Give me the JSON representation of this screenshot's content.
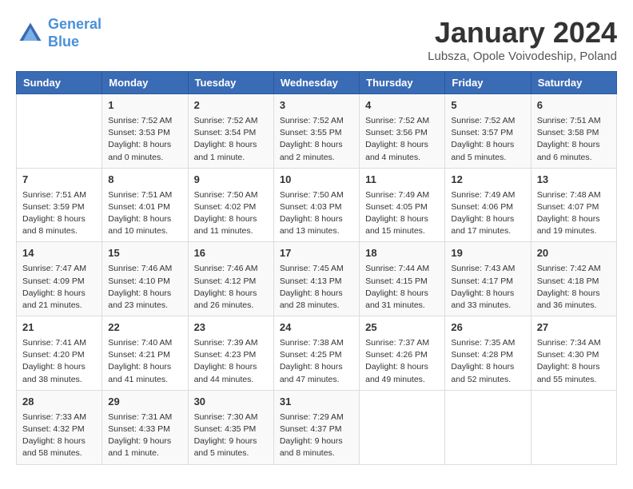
{
  "header": {
    "logo_line1": "General",
    "logo_line2": "Blue",
    "title": "January 2024",
    "subtitle": "Lubsza, Opole Voivodeship, Poland"
  },
  "weekdays": [
    "Sunday",
    "Monday",
    "Tuesday",
    "Wednesday",
    "Thursday",
    "Friday",
    "Saturday"
  ],
  "weeks": [
    [
      {
        "day": "",
        "info": ""
      },
      {
        "day": "1",
        "info": "Sunrise: 7:52 AM\nSunset: 3:53 PM\nDaylight: 8 hours\nand 0 minutes."
      },
      {
        "day": "2",
        "info": "Sunrise: 7:52 AM\nSunset: 3:54 PM\nDaylight: 8 hours\nand 1 minute."
      },
      {
        "day": "3",
        "info": "Sunrise: 7:52 AM\nSunset: 3:55 PM\nDaylight: 8 hours\nand 2 minutes."
      },
      {
        "day": "4",
        "info": "Sunrise: 7:52 AM\nSunset: 3:56 PM\nDaylight: 8 hours\nand 4 minutes."
      },
      {
        "day": "5",
        "info": "Sunrise: 7:52 AM\nSunset: 3:57 PM\nDaylight: 8 hours\nand 5 minutes."
      },
      {
        "day": "6",
        "info": "Sunrise: 7:51 AM\nSunset: 3:58 PM\nDaylight: 8 hours\nand 6 minutes."
      }
    ],
    [
      {
        "day": "7",
        "info": "Sunrise: 7:51 AM\nSunset: 3:59 PM\nDaylight: 8 hours\nand 8 minutes."
      },
      {
        "day": "8",
        "info": "Sunrise: 7:51 AM\nSunset: 4:01 PM\nDaylight: 8 hours\nand 10 minutes."
      },
      {
        "day": "9",
        "info": "Sunrise: 7:50 AM\nSunset: 4:02 PM\nDaylight: 8 hours\nand 11 minutes."
      },
      {
        "day": "10",
        "info": "Sunrise: 7:50 AM\nSunset: 4:03 PM\nDaylight: 8 hours\nand 13 minutes."
      },
      {
        "day": "11",
        "info": "Sunrise: 7:49 AM\nSunset: 4:05 PM\nDaylight: 8 hours\nand 15 minutes."
      },
      {
        "day": "12",
        "info": "Sunrise: 7:49 AM\nSunset: 4:06 PM\nDaylight: 8 hours\nand 17 minutes."
      },
      {
        "day": "13",
        "info": "Sunrise: 7:48 AM\nSunset: 4:07 PM\nDaylight: 8 hours\nand 19 minutes."
      }
    ],
    [
      {
        "day": "14",
        "info": "Sunrise: 7:47 AM\nSunset: 4:09 PM\nDaylight: 8 hours\nand 21 minutes."
      },
      {
        "day": "15",
        "info": "Sunrise: 7:46 AM\nSunset: 4:10 PM\nDaylight: 8 hours\nand 23 minutes."
      },
      {
        "day": "16",
        "info": "Sunrise: 7:46 AM\nSunset: 4:12 PM\nDaylight: 8 hours\nand 26 minutes."
      },
      {
        "day": "17",
        "info": "Sunrise: 7:45 AM\nSunset: 4:13 PM\nDaylight: 8 hours\nand 28 minutes."
      },
      {
        "day": "18",
        "info": "Sunrise: 7:44 AM\nSunset: 4:15 PM\nDaylight: 8 hours\nand 31 minutes."
      },
      {
        "day": "19",
        "info": "Sunrise: 7:43 AM\nSunset: 4:17 PM\nDaylight: 8 hours\nand 33 minutes."
      },
      {
        "day": "20",
        "info": "Sunrise: 7:42 AM\nSunset: 4:18 PM\nDaylight: 8 hours\nand 36 minutes."
      }
    ],
    [
      {
        "day": "21",
        "info": "Sunrise: 7:41 AM\nSunset: 4:20 PM\nDaylight: 8 hours\nand 38 minutes."
      },
      {
        "day": "22",
        "info": "Sunrise: 7:40 AM\nSunset: 4:21 PM\nDaylight: 8 hours\nand 41 minutes."
      },
      {
        "day": "23",
        "info": "Sunrise: 7:39 AM\nSunset: 4:23 PM\nDaylight: 8 hours\nand 44 minutes."
      },
      {
        "day": "24",
        "info": "Sunrise: 7:38 AM\nSunset: 4:25 PM\nDaylight: 8 hours\nand 47 minutes."
      },
      {
        "day": "25",
        "info": "Sunrise: 7:37 AM\nSunset: 4:26 PM\nDaylight: 8 hours\nand 49 minutes."
      },
      {
        "day": "26",
        "info": "Sunrise: 7:35 AM\nSunset: 4:28 PM\nDaylight: 8 hours\nand 52 minutes."
      },
      {
        "day": "27",
        "info": "Sunrise: 7:34 AM\nSunset: 4:30 PM\nDaylight: 8 hours\nand 55 minutes."
      }
    ],
    [
      {
        "day": "28",
        "info": "Sunrise: 7:33 AM\nSunset: 4:32 PM\nDaylight: 8 hours\nand 58 minutes."
      },
      {
        "day": "29",
        "info": "Sunrise: 7:31 AM\nSunset: 4:33 PM\nDaylight: 9 hours\nand 1 minute."
      },
      {
        "day": "30",
        "info": "Sunrise: 7:30 AM\nSunset: 4:35 PM\nDaylight: 9 hours\nand 5 minutes."
      },
      {
        "day": "31",
        "info": "Sunrise: 7:29 AM\nSunset: 4:37 PM\nDaylight: 9 hours\nand 8 minutes."
      },
      {
        "day": "",
        "info": ""
      },
      {
        "day": "",
        "info": ""
      },
      {
        "day": "",
        "info": ""
      }
    ]
  ]
}
